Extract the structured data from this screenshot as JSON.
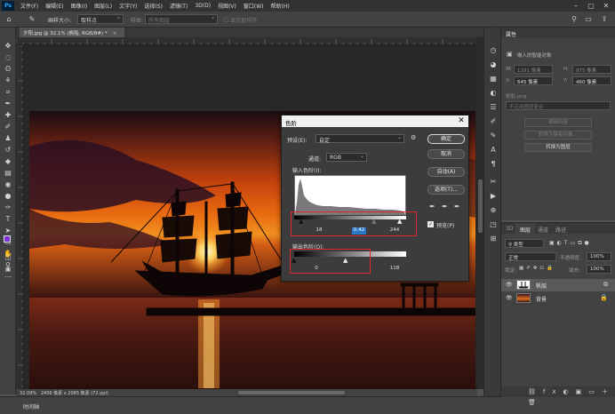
{
  "menu": [
    "文件(F)",
    "编辑(E)",
    "图像(I)",
    "图层(L)",
    "文字(Y)",
    "选择(S)",
    "滤镜(T)",
    "3D(D)",
    "视图(V)",
    "窗口(W)",
    "帮助(H)"
  ],
  "ps_logo": "Ps",
  "options": {
    "brush_size_label": "画样大小:",
    "brush_size_value": "取样点",
    "sample_label": "样本:",
    "sample_value": "所有图层",
    "show_ring": "显示取样环"
  },
  "document": {
    "tab": "夕阳.jpg @ 32.1% (帆船, RGB/8#) *",
    "zoom": "32.09%",
    "status": "2456 像素 x 2085 像素 (72 ppi)"
  },
  "timeline_label": "时间轴",
  "properties": {
    "tab": "属性",
    "layer_type": "嵌入的智能对象",
    "w_label": "W:",
    "w_value": "1191 像素",
    "h_label": "H:",
    "h_value": "975 像素",
    "x_label": "X:",
    "x_value": "645 像素",
    "y_label": "Y:",
    "y_value": "460 像素",
    "file_label": "帆船.png",
    "comp_value": "不应用图层复合",
    "edit_btn": "编辑内容",
    "convert_linked_btn": "转换为链接对象...",
    "convert_layers_btn": "转换为图层"
  },
  "layers": {
    "tabs": [
      "3D",
      "图层",
      "通道",
      "路径"
    ],
    "kind": "类型",
    "blend": "正常",
    "opacity_label": "不透明度:",
    "opacity": "100%",
    "lock_label": "锁定:",
    "fill_label": "填充:",
    "fill": "100%",
    "items": [
      {
        "name": "帆船"
      },
      {
        "name": "背景"
      }
    ]
  },
  "levels": {
    "title": "色阶",
    "preset_label": "预设(E):",
    "preset_value": "自定",
    "channel_label": "通道:",
    "channel_value": "RGB",
    "input_label": "输入色阶(I):",
    "output_label": "输出色阶(O):",
    "input_black": "18",
    "input_gamma": "0.42",
    "input_white": "244",
    "output_black": "0",
    "output_white": "118",
    "buttons": [
      "确定",
      "取消",
      "自动(A)",
      "选项(T)..."
    ],
    "preview_label": "预览(P)",
    "preview_checked": true
  }
}
